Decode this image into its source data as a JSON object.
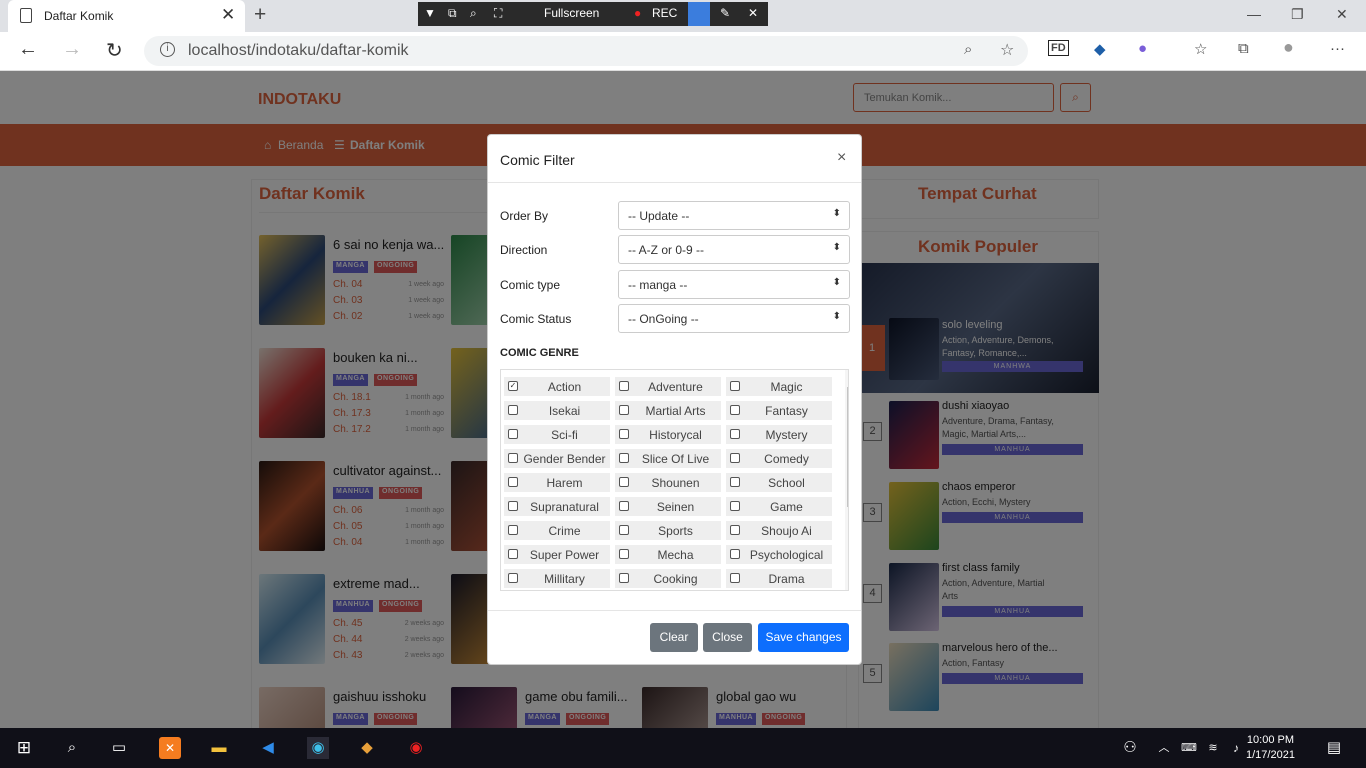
{
  "browser": {
    "tab_title": "Daftar Komik",
    "url": "localhost/indotaku/daftar-komik",
    "recorder": {
      "fullscreen_label": "Fullscreen",
      "rec_label": "REC"
    }
  },
  "site": {
    "brand": "INDOTAKU",
    "search_placeholder": "Temukan Komik...",
    "nav": {
      "home": "Beranda",
      "list": "Daftar Komik"
    },
    "list_title": "Daftar Komik",
    "side_title_1": "Tempat Curhat",
    "side_title_2": "Komik Populer"
  },
  "comics": [
    {
      "title": "6 sai no kenja wa...",
      "type": "MANGA",
      "status": "ONGOING",
      "chapters": [
        {
          "ch": "Ch. 04",
          "ago": "1 week ago"
        },
        {
          "ch": "Ch. 03",
          "ago": "1 week ago"
        },
        {
          "ch": "Ch. 02",
          "ago": "1 week ago"
        }
      ]
    },
    {
      "title": "bouken ka ni...",
      "type": "MANGA",
      "status": "ONGOING",
      "chapters": [
        {
          "ch": "Ch. 18.1",
          "ago": "1 month ago"
        },
        {
          "ch": "Ch. 17.3",
          "ago": "1 month ago"
        },
        {
          "ch": "Ch. 17.2",
          "ago": "1 month ago"
        }
      ]
    },
    {
      "title": "cultivator against...",
      "type": "MANHUA",
      "status": "ONGOING",
      "chapters": [
        {
          "ch": "Ch. 06",
          "ago": "1 month ago"
        },
        {
          "ch": "Ch. 05",
          "ago": "1 month ago"
        },
        {
          "ch": "Ch. 04",
          "ago": "1 month ago"
        }
      ]
    },
    {
      "title": "extreme mad...",
      "type": "MANHUA",
      "status": "ONGOING",
      "chapters": [
        {
          "ch": "Ch. 45",
          "ago": "2 weeks ago"
        },
        {
          "ch": "Ch. 44",
          "ago": "2 weeks ago"
        },
        {
          "ch": "Ch. 43",
          "ago": "2 weeks ago"
        }
      ]
    },
    {
      "title": "gaishuu isshoku",
      "type": "MANGA",
      "status": "ONGOING",
      "chapters": []
    },
    {
      "title": "game obu famili...",
      "type": "MANGA",
      "status": "ONGOING",
      "chapters": []
    },
    {
      "title": "global gao wu",
      "type": "MANHUA",
      "status": "ONGOING",
      "chapters": []
    }
  ],
  "popular": [
    {
      "rank": "1",
      "title": "solo leveling",
      "genres": "Action, Adventure, Demons, Fantasy, Romance,...",
      "type": "MANHWA"
    },
    {
      "rank": "2",
      "title": "dushi xiaoyao",
      "genres": "Adventure, Drama, Fantasy, Magic, Martial Arts,...",
      "type": "MANHUA"
    },
    {
      "rank": "3",
      "title": "chaos emperor",
      "genres": "Action, Ecchi, Mystery",
      "type": "MANHUA"
    },
    {
      "rank": "4",
      "title": "first class family",
      "genres": "Action, Adventure, Martial Arts",
      "type": "MANHUA"
    },
    {
      "rank": "5",
      "title": "marvelous hero of the...",
      "genres": "Action, Fantasy",
      "type": "MANHUA"
    }
  ],
  "modal": {
    "title": "Comic Filter",
    "close_symbol": "×",
    "fields": [
      {
        "label": "Order By",
        "value": "-- Update --"
      },
      {
        "label": "Direction",
        "value": "-- A-Z or 0-9 --"
      },
      {
        "label": "Comic type",
        "value": "-- manga --"
      },
      {
        "label": "Comic Status",
        "value": "-- OnGoing --"
      }
    ],
    "genre_heading": "COMIC GENRE",
    "genres": [
      {
        "label": "Action",
        "checked": true
      },
      {
        "label": "Adventure",
        "checked": false
      },
      {
        "label": "Magic",
        "checked": false
      },
      {
        "label": "Isekai",
        "checked": false
      },
      {
        "label": "Martial Arts",
        "checked": false
      },
      {
        "label": "Fantasy",
        "checked": false
      },
      {
        "label": "Sci-fi",
        "checked": false
      },
      {
        "label": "Historycal",
        "checked": false
      },
      {
        "label": "Mystery",
        "checked": false
      },
      {
        "label": "Gender Bender",
        "checked": false
      },
      {
        "label": "Slice Of Live",
        "checked": false
      },
      {
        "label": "Comedy",
        "checked": false
      },
      {
        "label": "Harem",
        "checked": false
      },
      {
        "label": "Shounen",
        "checked": false
      },
      {
        "label": "School",
        "checked": false
      },
      {
        "label": "Supranatural",
        "checked": false
      },
      {
        "label": "Seinen",
        "checked": false
      },
      {
        "label": "Game",
        "checked": false
      },
      {
        "label": "Crime",
        "checked": false
      },
      {
        "label": "Sports",
        "checked": false
      },
      {
        "label": "Shoujo Ai",
        "checked": false
      },
      {
        "label": "Super Power",
        "checked": false
      },
      {
        "label": "Mecha",
        "checked": false
      },
      {
        "label": "Psychological",
        "checked": false
      },
      {
        "label": "Millitary",
        "checked": false
      },
      {
        "label": "Cooking",
        "checked": false
      },
      {
        "label": "Drama",
        "checked": false
      }
    ],
    "buttons": {
      "clear": "Clear",
      "close": "Close",
      "save": "Save changes"
    }
  },
  "taskbar": {
    "time": "10:00 PM",
    "date": "1/17/2021"
  },
  "colors": {
    "accent": "#e0643f",
    "manga_badge": "#6a68d8",
    "ongoing_badge": "#e05a5a",
    "primary_button": "#0d6efd",
    "secondary_button": "#6c757d"
  }
}
